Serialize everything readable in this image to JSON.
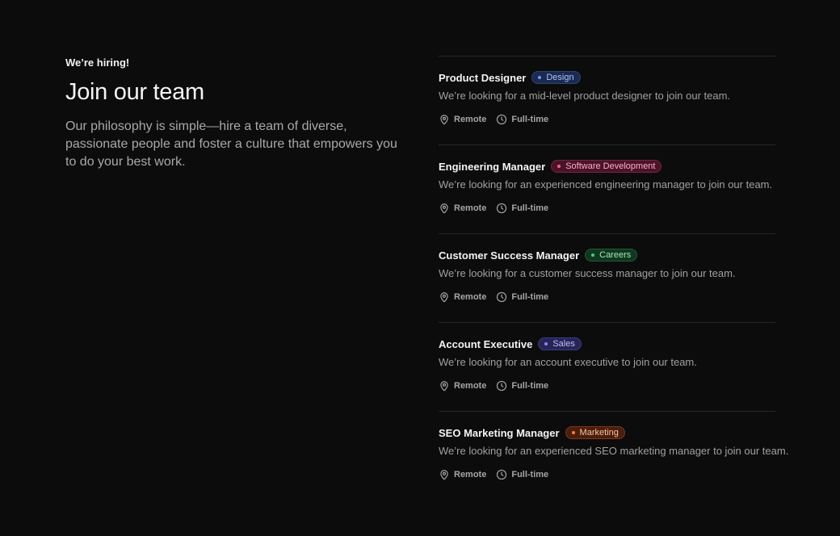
{
  "intro": {
    "eyebrow": "We’re hiring!",
    "title": "Join our team",
    "subtitle": "Our philosophy is simple—hire a team of diverse, passionate people and foster a culture that empowers you to do your best work."
  },
  "jobs": [
    {
      "title": "Product Designer",
      "tag": "Design",
      "tag_colors": {
        "bg": "#1b2a4d",
        "border": "#2c437a",
        "text": "#a7c1ff",
        "dot": "#6f95ff"
      },
      "description": "We’re looking for a mid-level product designer to join our team.",
      "location": "Remote",
      "type": "Full-time"
    },
    {
      "title": "Engineering Manager",
      "tag": "Software Development",
      "tag_colors": {
        "bg": "#4a1428",
        "border": "#7a2141",
        "text": "#ffadc8",
        "dot": "#ff5c93"
      },
      "description": "We’re looking for an experienced engineering manager to join our team.",
      "location": "Remote",
      "type": "Full-time"
    },
    {
      "title": "Customer Success Manager",
      "tag": "Careers",
      "tag_colors": {
        "bg": "#123620",
        "border": "#1e5a34",
        "text": "#9fe9b8",
        "dot": "#41d27a"
      },
      "description": "We’re looking for a customer success manager to join our team.",
      "location": "Remote",
      "type": "Full-time"
    },
    {
      "title": "Account Executive",
      "tag": "Sales",
      "tag_colors": {
        "bg": "#272456",
        "border": "#3e3a86",
        "text": "#c0bcff",
        "dot": "#8c84ff"
      },
      "description": "We’re looking for an account executive to join our team.",
      "location": "Remote",
      "type": "Full-time"
    },
    {
      "title": "SEO Marketing Manager",
      "tag": "Marketing",
      "tag_colors": {
        "bg": "#4a1e0e",
        "border": "#7d3618",
        "text": "#ffc09e",
        "dot": "#ff7b3d"
      },
      "description": "We’re looking for an experienced SEO marketing manager to join our team.",
      "location": "Remote",
      "type": "Full-time"
    }
  ],
  "icons": {
    "location": "map-pin-icon",
    "type": "clock-icon"
  }
}
